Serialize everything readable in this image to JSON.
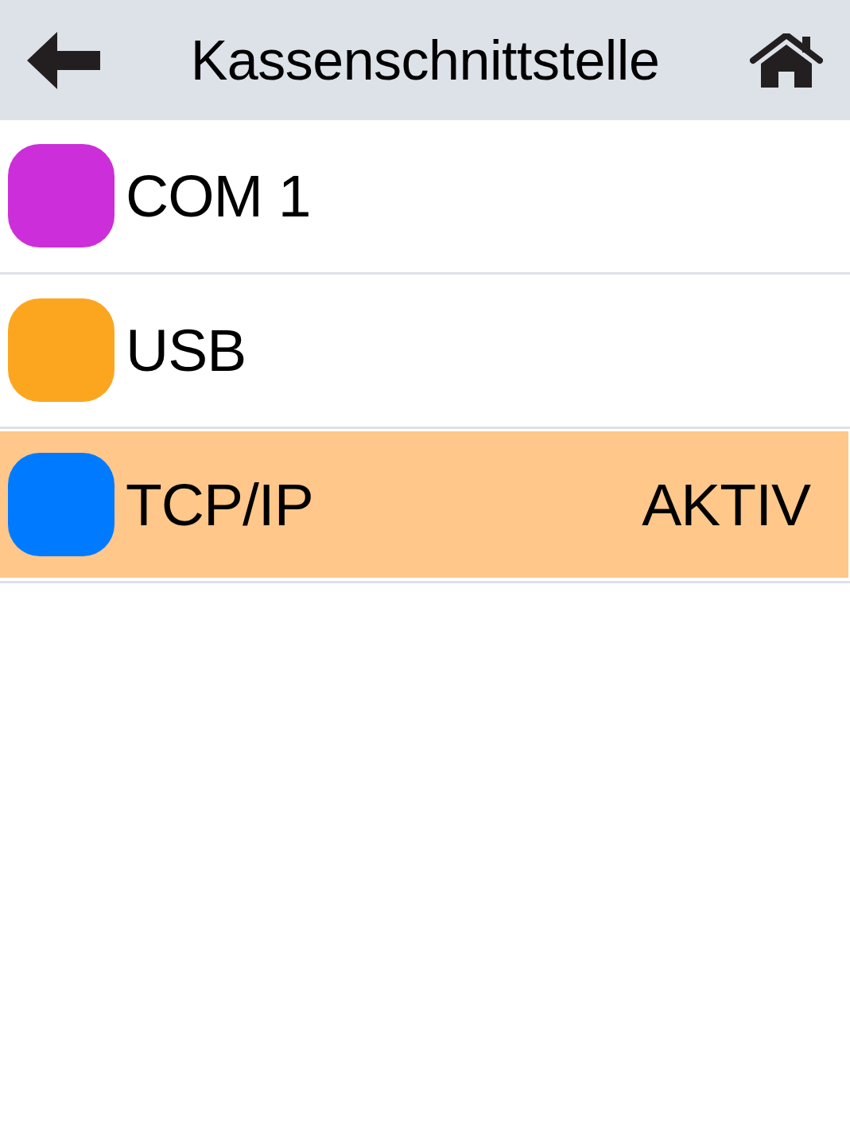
{
  "header": {
    "title": "Kassenschnittstelle"
  },
  "interfaces": [
    {
      "label": "COM 1",
      "color": "#cc2fd9",
      "selected": false
    },
    {
      "label": "USB",
      "color": "#fca620",
      "selected": false
    },
    {
      "label": "TCP/IP",
      "color": "#007bff",
      "selected": true,
      "status": "AKTIV"
    }
  ]
}
